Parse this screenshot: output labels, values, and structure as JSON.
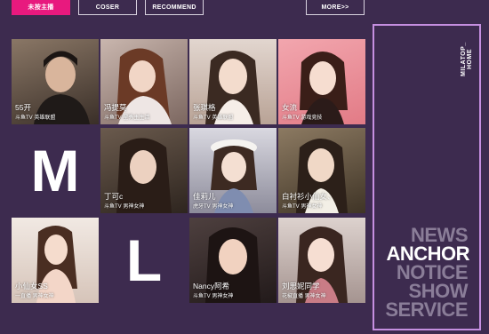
{
  "tabs": [
    {
      "label": "未按主播",
      "active": true
    },
    {
      "label": "COSER",
      "active": false
    },
    {
      "label": "RECOMMEND",
      "active": false
    },
    {
      "label": "MORE>>",
      "active": false
    }
  ],
  "tiles": [
    {
      "name": "55开",
      "sub": "斗鱼TV 英雄联盟",
      "bg": "#6e5a49"
    },
    {
      "name": "冯提莫",
      "sub": "斗鱼TV 星秀主生活",
      "bg": "#a98f86"
    },
    {
      "name": "张琪格",
      "sub": "斗鱼TV 英雄联盟",
      "bg": "#c9b3a6"
    },
    {
      "name": "女流",
      "sub": "斗鱼TV 游戏竞技",
      "bg": "#e99aa0"
    },
    {
      "name": "丁可c",
      "sub": "斗鱼TV 男神女神",
      "bg": "#5d4a3e"
    },
    {
      "name": "佳莉儿",
      "sub": "虎牙TV 男神女神",
      "bg": "#b8b7c3"
    },
    {
      "name": "白衬衫小仙女、",
      "sub": "斗鱼TV 男神女神",
      "bg": "#6b5a45"
    },
    {
      "name": "小仙女SS",
      "sub": "一直播 男神女神",
      "bg": "#e8dbd2"
    },
    {
      "name": "Nancy阿希",
      "sub": "斗鱼TV 男神女神",
      "bg": "#3c3030"
    },
    {
      "name": "刘思妮同学",
      "sub": "花椒直播 男神女神",
      "bg": "#cdbdb7"
    }
  ],
  "letters": {
    "m": "M",
    "l": "L"
  },
  "panel": {
    "vertical_label": "MILATOP_ HOME",
    "menu": [
      {
        "label": "NEWS",
        "current": false
      },
      {
        "label": "ANCHOR",
        "current": true
      },
      {
        "label": "NOTICE",
        "current": false
      },
      {
        "label": "SHOW",
        "current": false
      },
      {
        "label": "SERVICE",
        "current": false
      }
    ]
  },
  "colors": {
    "accent": "#e8197e",
    "background": "#3d2b4f",
    "panel_border": "#c58fe0"
  }
}
